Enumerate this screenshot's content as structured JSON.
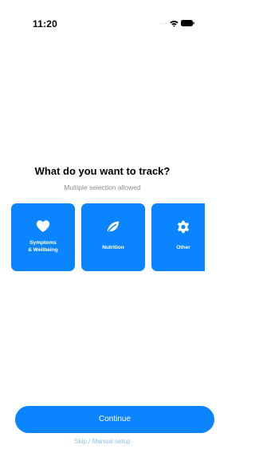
{
  "status_bar": {
    "time": "11:20",
    "signal": "....",
    "icons": [
      "signal-dots",
      "wifi-icon",
      "battery-icon"
    ]
  },
  "header": {
    "title": "What do you want to track?",
    "subtitle": "Multiple selection allowed"
  },
  "options": [
    {
      "label": "Symptoms\n& Wellbeing",
      "icon": "heart-icon"
    },
    {
      "label": "Nutrition",
      "icon": "leaf-icon"
    },
    {
      "label": "Other",
      "icon": "gear-icon"
    }
  ],
  "footer": {
    "continue_label": "Continue",
    "skip_label": "Skip / Manual setup"
  },
  "colors": {
    "accent": "#0a84ff",
    "subtitle_text": "#8e8e93",
    "skip_link": "#8fc2f5",
    "background": "#ffffff"
  }
}
